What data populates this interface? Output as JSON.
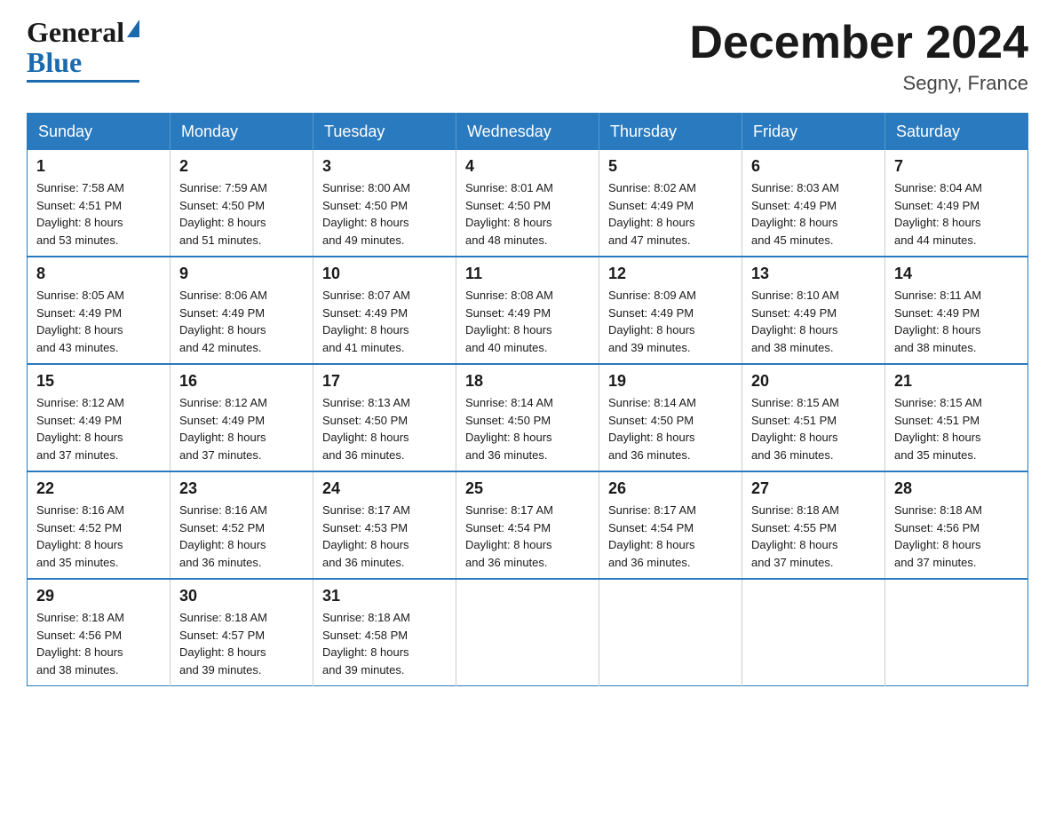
{
  "logo": {
    "general": "General",
    "blue": "Blue"
  },
  "title": "December 2024",
  "subtitle": "Segny, France",
  "header_days": [
    "Sunday",
    "Monday",
    "Tuesday",
    "Wednesday",
    "Thursday",
    "Friday",
    "Saturday"
  ],
  "weeks": [
    [
      {
        "day": "1",
        "sunrise": "7:58 AM",
        "sunset": "4:51 PM",
        "daylight": "8 hours and 53 minutes."
      },
      {
        "day": "2",
        "sunrise": "7:59 AM",
        "sunset": "4:50 PM",
        "daylight": "8 hours and 51 minutes."
      },
      {
        "day": "3",
        "sunrise": "8:00 AM",
        "sunset": "4:50 PM",
        "daylight": "8 hours and 49 minutes."
      },
      {
        "day": "4",
        "sunrise": "8:01 AM",
        "sunset": "4:50 PM",
        "daylight": "8 hours and 48 minutes."
      },
      {
        "day": "5",
        "sunrise": "8:02 AM",
        "sunset": "4:49 PM",
        "daylight": "8 hours and 47 minutes."
      },
      {
        "day": "6",
        "sunrise": "8:03 AM",
        "sunset": "4:49 PM",
        "daylight": "8 hours and 45 minutes."
      },
      {
        "day": "7",
        "sunrise": "8:04 AM",
        "sunset": "4:49 PM",
        "daylight": "8 hours and 44 minutes."
      }
    ],
    [
      {
        "day": "8",
        "sunrise": "8:05 AM",
        "sunset": "4:49 PM",
        "daylight": "8 hours and 43 minutes."
      },
      {
        "day": "9",
        "sunrise": "8:06 AM",
        "sunset": "4:49 PM",
        "daylight": "8 hours and 42 minutes."
      },
      {
        "day": "10",
        "sunrise": "8:07 AM",
        "sunset": "4:49 PM",
        "daylight": "8 hours and 41 minutes."
      },
      {
        "day": "11",
        "sunrise": "8:08 AM",
        "sunset": "4:49 PM",
        "daylight": "8 hours and 40 minutes."
      },
      {
        "day": "12",
        "sunrise": "8:09 AM",
        "sunset": "4:49 PM",
        "daylight": "8 hours and 39 minutes."
      },
      {
        "day": "13",
        "sunrise": "8:10 AM",
        "sunset": "4:49 PM",
        "daylight": "8 hours and 38 minutes."
      },
      {
        "day": "14",
        "sunrise": "8:11 AM",
        "sunset": "4:49 PM",
        "daylight": "8 hours and 38 minutes."
      }
    ],
    [
      {
        "day": "15",
        "sunrise": "8:12 AM",
        "sunset": "4:49 PM",
        "daylight": "8 hours and 37 minutes."
      },
      {
        "day": "16",
        "sunrise": "8:12 AM",
        "sunset": "4:49 PM",
        "daylight": "8 hours and 37 minutes."
      },
      {
        "day": "17",
        "sunrise": "8:13 AM",
        "sunset": "4:50 PM",
        "daylight": "8 hours and 36 minutes."
      },
      {
        "day": "18",
        "sunrise": "8:14 AM",
        "sunset": "4:50 PM",
        "daylight": "8 hours and 36 minutes."
      },
      {
        "day": "19",
        "sunrise": "8:14 AM",
        "sunset": "4:50 PM",
        "daylight": "8 hours and 36 minutes."
      },
      {
        "day": "20",
        "sunrise": "8:15 AM",
        "sunset": "4:51 PM",
        "daylight": "8 hours and 36 minutes."
      },
      {
        "day": "21",
        "sunrise": "8:15 AM",
        "sunset": "4:51 PM",
        "daylight": "8 hours and 35 minutes."
      }
    ],
    [
      {
        "day": "22",
        "sunrise": "8:16 AM",
        "sunset": "4:52 PM",
        "daylight": "8 hours and 35 minutes."
      },
      {
        "day": "23",
        "sunrise": "8:16 AM",
        "sunset": "4:52 PM",
        "daylight": "8 hours and 36 minutes."
      },
      {
        "day": "24",
        "sunrise": "8:17 AM",
        "sunset": "4:53 PM",
        "daylight": "8 hours and 36 minutes."
      },
      {
        "day": "25",
        "sunrise": "8:17 AM",
        "sunset": "4:54 PM",
        "daylight": "8 hours and 36 minutes."
      },
      {
        "day": "26",
        "sunrise": "8:17 AM",
        "sunset": "4:54 PM",
        "daylight": "8 hours and 36 minutes."
      },
      {
        "day": "27",
        "sunrise": "8:18 AM",
        "sunset": "4:55 PM",
        "daylight": "8 hours and 37 minutes."
      },
      {
        "day": "28",
        "sunrise": "8:18 AM",
        "sunset": "4:56 PM",
        "daylight": "8 hours and 37 minutes."
      }
    ],
    [
      {
        "day": "29",
        "sunrise": "8:18 AM",
        "sunset": "4:56 PM",
        "daylight": "8 hours and 38 minutes."
      },
      {
        "day": "30",
        "sunrise": "8:18 AM",
        "sunset": "4:57 PM",
        "daylight": "8 hours and 39 minutes."
      },
      {
        "day": "31",
        "sunrise": "8:18 AM",
        "sunset": "4:58 PM",
        "daylight": "8 hours and 39 minutes."
      },
      null,
      null,
      null,
      null
    ]
  ],
  "labels": {
    "sunrise": "Sunrise:",
    "sunset": "Sunset:",
    "daylight": "Daylight:"
  }
}
